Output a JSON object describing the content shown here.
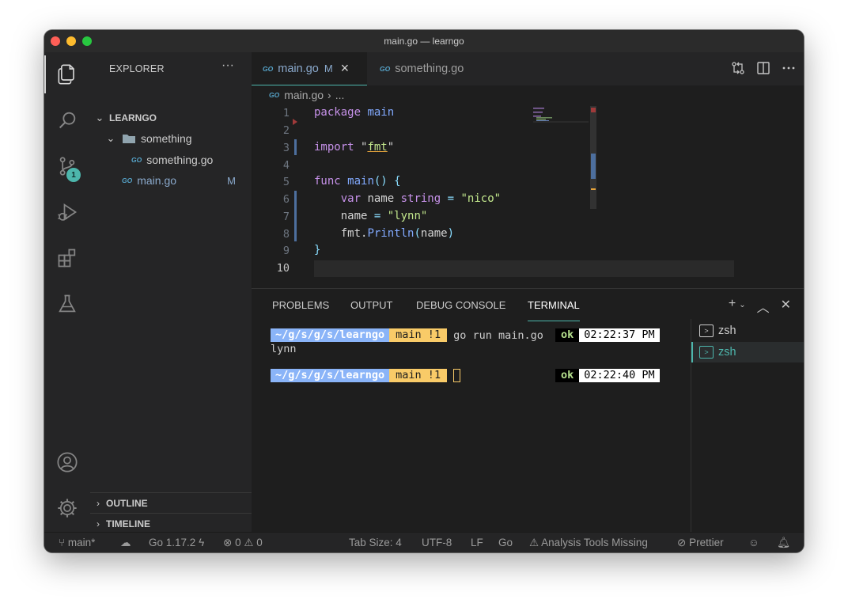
{
  "window": {
    "title": "main.go — learngo"
  },
  "activity": {
    "scm_badge": "1"
  },
  "explorer": {
    "header": "EXPLORER",
    "more": "···",
    "root": "LEARNGO",
    "folder": "something",
    "file_in_folder": "something.go",
    "file_main": "main.go",
    "file_main_status": "M",
    "outline": "OUTLINE",
    "timeline": "TIMELINE"
  },
  "tabs": [
    {
      "label": "main.go",
      "status": "M",
      "close": "×",
      "go": "GO"
    },
    {
      "label": "something.go",
      "go": "GO"
    }
  ],
  "breadcrumb": {
    "file": "main.go",
    "sep": "›",
    "rest": "..."
  },
  "editor": {
    "line_numbers": [
      "1",
      "2",
      "3",
      "4",
      "5",
      "6",
      "7",
      "8",
      "9",
      "10"
    ],
    "lines": [
      "package main",
      "",
      "import \"fmt\"",
      "",
      "func main() {",
      "    var name string = \"nico\"",
      "    name = \"lynn\"",
      "    fmt.Println(name)",
      "}",
      ""
    ]
  },
  "panel": {
    "tabs": [
      "PROBLEMS",
      "OUTPUT",
      "DEBUG CONSOLE",
      "TERMINAL"
    ],
    "active_tab": "TERMINAL",
    "terminal": {
      "prompt_path": "~/g/s/g/s/learngo",
      "prompt_git": "main !1",
      "command": "go run main.go",
      "output": "lynn",
      "status": "ok",
      "time1": "02:22:37 PM",
      "time2": "02:22:40 PM"
    },
    "terminals": [
      "zsh",
      "zsh"
    ]
  },
  "statusbar": {
    "branch": "main*",
    "go_version": "Go 1.17.2",
    "errors": "0",
    "warnings": "0",
    "tab_size": "Tab Size: 4",
    "encoding": "UTF-8",
    "eol": "LF",
    "language": "Go",
    "analysis": "Analysis Tools Missing",
    "prettier": "Prettier"
  },
  "colors": {
    "accent": "#4db6ac",
    "keyword": "#c792ea",
    "string": "#c3e88d",
    "function": "#82aaff"
  }
}
